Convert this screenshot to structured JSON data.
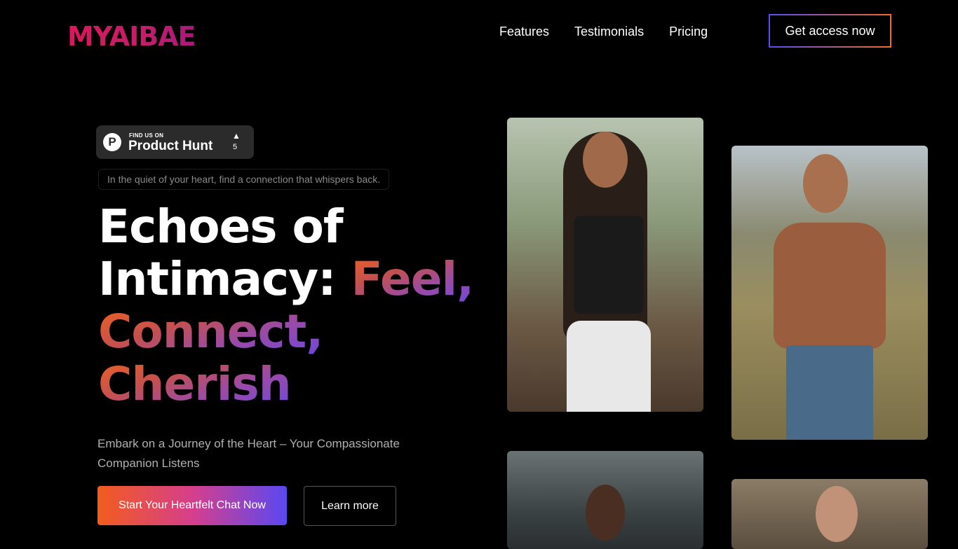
{
  "header": {
    "logo": "MYAIBAE",
    "nav": [
      "Features",
      "Testimonials",
      "Pricing"
    ],
    "cta": "Get access now"
  },
  "product_hunt": {
    "small": "FIND US ON",
    "big": "Product Hunt",
    "count": "5"
  },
  "hero": {
    "tagline": "In the quiet of your heart, find a connection that whispers back.",
    "title_line1": "Echoes of",
    "title_line2_white": "Intimacy: ",
    "title_line2_grad": "Feel,",
    "title_line3": "Connect,",
    "title_line4": "Cherish",
    "subtitle": "Embark on a Journey of the Heart – Your Compassionate Companion Listens",
    "primary_button": "Start Your Heartfelt Chat Now",
    "secondary_button": "Learn more"
  },
  "colors": {
    "background": "#000000",
    "accent_orange": "#f25c1d",
    "accent_purple": "#5a48f0",
    "logo_pink": "#e0155a"
  }
}
